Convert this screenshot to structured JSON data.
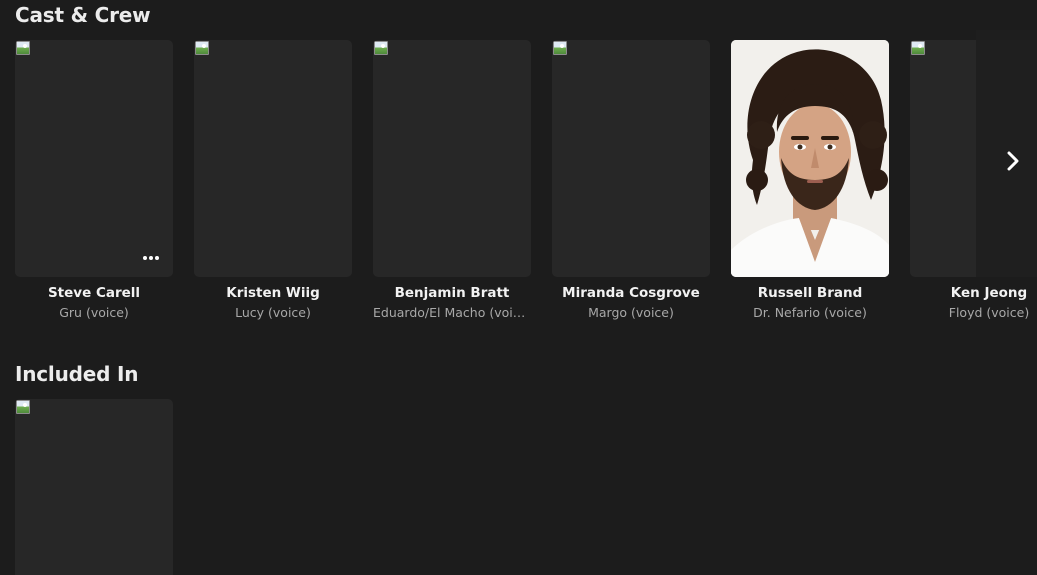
{
  "sections": {
    "cast_title": "Cast & Crew",
    "included_title": "Included In"
  },
  "cast": [
    {
      "name": "Steve Carell",
      "role": "Gru (voice)"
    },
    {
      "name": "Kristen Wiig",
      "role": "Lucy (voice)"
    },
    {
      "name": "Benjamin Bratt",
      "role": "Eduardo/El Macho (voice)"
    },
    {
      "name": "Miranda Cosgrove",
      "role": "Margo (voice)"
    },
    {
      "name": "Russell Brand",
      "role": "Dr. Nefario (voice)"
    },
    {
      "name": "Ken Jeong",
      "role": "Floyd (voice)"
    }
  ],
  "icons": {
    "more": "more-horizontal-icon",
    "next": "chevron-right-icon",
    "broken_image": "broken-image-icon"
  },
  "colors": {
    "background": "#1c1c1c",
    "card": "#272727",
    "text_primary": "#f2f2f2",
    "text_secondary": "#a8a8a8"
  }
}
